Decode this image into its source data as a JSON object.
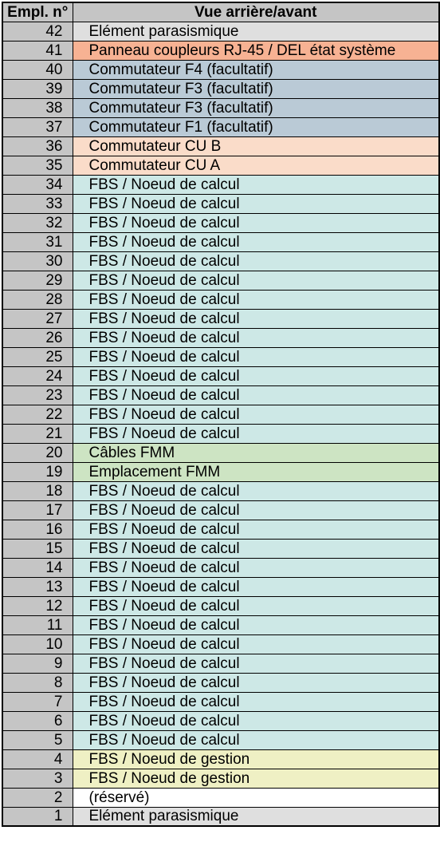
{
  "header": {
    "col1": "Empl. n°",
    "col2": "Vue arrière/avant"
  },
  "rows": [
    {
      "n": "42",
      "label": "Elément parasismique",
      "cls": "c-gray"
    },
    {
      "n": "41",
      "label": "Panneau coupleurs RJ-45 / DEL état système",
      "cls": "c-salmon",
      "small": true
    },
    {
      "n": "40",
      "label": "Commutateur F4 (facultatif)",
      "cls": "c-steel"
    },
    {
      "n": "39",
      "label": "Commutateur F3 (facultatif)",
      "cls": "c-steel"
    },
    {
      "n": "38",
      "label": "Commutateur F3 (facultatif)",
      "cls": "c-steel"
    },
    {
      "n": "37",
      "label": "Commutateur F1 (facultatif)",
      "cls": "c-steel"
    },
    {
      "n": "36",
      "label": "Commutateur CU B",
      "cls": "c-peach"
    },
    {
      "n": "35",
      "label": "Commutateur CU A",
      "cls": "c-peach"
    },
    {
      "n": "34",
      "label": "FBS / Noeud de calcul",
      "cls": "c-aqua"
    },
    {
      "n": "33",
      "label": "FBS / Noeud de calcul",
      "cls": "c-aqua"
    },
    {
      "n": "32",
      "label": "FBS / Noeud de calcul",
      "cls": "c-aqua"
    },
    {
      "n": "31",
      "label": "FBS / Noeud de calcul",
      "cls": "c-aqua"
    },
    {
      "n": "30",
      "label": "FBS / Noeud de calcul",
      "cls": "c-aqua"
    },
    {
      "n": "29",
      "label": "FBS / Noeud de calcul",
      "cls": "c-aqua"
    },
    {
      "n": "28",
      "label": "FBS / Noeud de calcul",
      "cls": "c-aqua"
    },
    {
      "n": "27",
      "label": "FBS / Noeud de calcul",
      "cls": "c-aqua"
    },
    {
      "n": "26",
      "label": "FBS / Noeud de calcul",
      "cls": "c-aqua"
    },
    {
      "n": "25",
      "label": "FBS / Noeud de calcul",
      "cls": "c-aqua"
    },
    {
      "n": "24",
      "label": "FBS / Noeud de calcul",
      "cls": "c-aqua"
    },
    {
      "n": "23",
      "label": "FBS / Noeud de calcul",
      "cls": "c-aqua"
    },
    {
      "n": "22",
      "label": "FBS / Noeud de calcul",
      "cls": "c-aqua"
    },
    {
      "n": "21",
      "label": "FBS / Noeud de calcul",
      "cls": "c-aqua"
    },
    {
      "n": "20",
      "label": "Câbles FMM",
      "cls": "c-green"
    },
    {
      "n": "19",
      "label": "Emplacement FMM",
      "cls": "c-green"
    },
    {
      "n": "18",
      "label": "FBS / Noeud de calcul",
      "cls": "c-aqua"
    },
    {
      "n": "17",
      "label": "FBS / Noeud de calcul",
      "cls": "c-aqua"
    },
    {
      "n": "16",
      "label": "FBS / Noeud de calcul",
      "cls": "c-aqua"
    },
    {
      "n": "15",
      "label": "FBS / Noeud de calcul",
      "cls": "c-aqua"
    },
    {
      "n": "14",
      "label": "FBS / Noeud de calcul",
      "cls": "c-aqua"
    },
    {
      "n": "13",
      "label": "FBS / Noeud de calcul",
      "cls": "c-aqua"
    },
    {
      "n": "12",
      "label": "FBS / Noeud de calcul",
      "cls": "c-aqua"
    },
    {
      "n": "11",
      "label": "FBS / Noeud de calcul",
      "cls": "c-aqua"
    },
    {
      "n": "10",
      "label": "FBS / Noeud de calcul",
      "cls": "c-aqua"
    },
    {
      "n": "9",
      "label": "FBS / Noeud de calcul",
      "cls": "c-aqua"
    },
    {
      "n": "8",
      "label": "FBS / Noeud de calcul",
      "cls": "c-aqua"
    },
    {
      "n": "7",
      "label": "FBS / Noeud de calcul",
      "cls": "c-aqua"
    },
    {
      "n": "6",
      "label": "FBS / Noeud de calcul",
      "cls": "c-aqua"
    },
    {
      "n": "5",
      "label": "FBS / Noeud de calcul",
      "cls": "c-aqua"
    },
    {
      "n": "4",
      "label": "FBS / Noeud de gestion",
      "cls": "c-yellow"
    },
    {
      "n": "3",
      "label": "FBS / Noeud de gestion",
      "cls": "c-yellow"
    },
    {
      "n": "2",
      "label": "(réservé)",
      "cls": "c-white"
    },
    {
      "n": "1",
      "label": "Elément parasismique",
      "cls": "c-gray"
    }
  ]
}
